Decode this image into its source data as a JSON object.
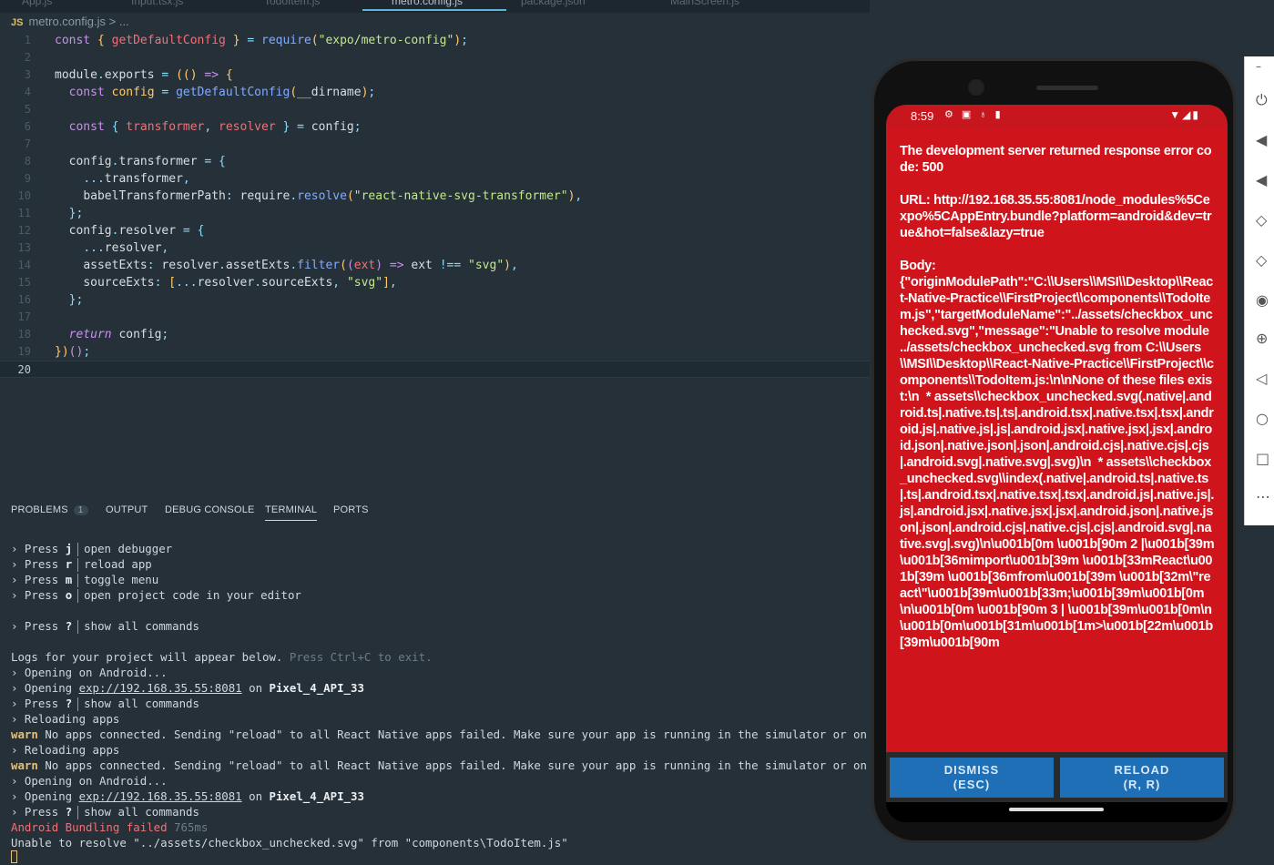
{
  "tabs": [
    {
      "label": "App.js",
      "active": false
    },
    {
      "label": "Input.tsx.js",
      "active": false
    },
    {
      "label": "TodoItem.js",
      "active": false
    },
    {
      "label": "metro.config.js",
      "active": true
    },
    {
      "label": "package.json",
      "active": false
    },
    {
      "label": "MainScreen.js",
      "active": false
    }
  ],
  "breadcrumb": {
    "lang": "JS",
    "file": "metro.config.js",
    "rest": "> ..."
  },
  "editor": {
    "line_numbers": [
      "1",
      "2",
      "3",
      "4",
      "5",
      "6",
      "7",
      "8",
      "9",
      "10",
      "11",
      "12",
      "13",
      "14",
      "15",
      "16",
      "17",
      "18",
      "19",
      "20"
    ],
    "current_line": "20"
  },
  "panel": {
    "tabs": [
      "PROBLEMS",
      "OUTPUT",
      "DEBUG CONSOLE",
      "TERMINAL",
      "PORTS"
    ],
    "problems_count": "1",
    "active_tab": "TERMINAL"
  },
  "terminal": {
    "press_j": "open debugger",
    "press_r": "reload app",
    "press_m": "toggle menu",
    "press_o": "open project code in your editor",
    "press_q": "show all commands",
    "logs_text": "Logs for your project will appear below.",
    "logs_hint": "Press Ctrl+C to exit.",
    "opening_android": "Opening on Android...",
    "exp_url": "exp://192.168.35.55:8081",
    "device": "Pixel_4_API_33",
    "reloading": "Reloading apps",
    "warn_label": "warn",
    "warn_text": "No apps connected. Sending \"reload\" to all React Native apps failed. Make sure your app is running in the simulator or on a phone",
    "bundling_failed": "Android Bundling failed",
    "bundling_time": "765ms",
    "unable": "Unable to resolve \"../assets/checkbox_unchecked.svg\" from \"components\\TodoItem.js\""
  },
  "phone": {
    "time": "8:59",
    "error_message": "The development server returned response error code: 500\n\nURL: http://192.168.35.55:8081/node_modules%5Cexpo%5CAppEntry.bundle?platform=android&dev=true&hot=false&lazy=true\n\nBody:\n{\"originModulePath\":\"C:\\\\Users\\\\MSI\\\\Desktop\\\\React-Native-Practice\\\\FirstProject\\\\components\\\\TodoItem.js\",\"targetModuleName\":\"../assets/checkbox_unchecked.svg\",\"message\":\"Unable to resolve module ../assets/checkbox_unchecked.svg from C:\\\\Users\\\\MSI\\\\Desktop\\\\React-Native-Practice\\\\FirstProject\\\\components\\\\TodoItem.js:\\n\\nNone of these files exist:\\n  * assets\\\\checkbox_unchecked.svg(.native|.android.ts|.native.ts|.ts|.android.tsx|.native.tsx|.tsx|.android.js|.native.js|.js|.android.jsx|.native.jsx|.jsx|.android.json|.native.json|.json|.android.cjs|.native.cjs|.cjs|.android.svg|.native.svg|.svg)\\n  * assets\\\\checkbox_unchecked.svg\\\\index(.native|.android.ts|.native.ts|.ts|.android.tsx|.native.tsx|.tsx|.android.js|.native.js|.js|.android.jsx|.native.jsx|.jsx|.android.json|.native.json|.json|.android.cjs|.native.cjs|.cjs|.android.svg|.native.svg|.svg)\\n\\u001b[0m \\u001b[90m 2 |\\u001b[39m \\u001b[36mimport\\u001b[39m \\u001b[33mReact\\u001b[39m \\u001b[36mfrom\\u001b[39m \\u001b[32m\\\"react\\\"\\u001b[39m\\u001b[33m;\\u001b[39m\\u001b[0m\\n\\u001b[0m \\u001b[90m 3 | \\u001b[39m\\u001b[0m\\n\\u001b[0m\\u001b[31m\\u001b[1m>\\u001b[22m\\u001b[39m\\u001b[90m",
    "dismiss": "DISMISS",
    "dismiss_key": "(ESC)",
    "reload": "RELOAD",
    "reload_key": "(R, R)"
  },
  "colors": {
    "error_red": "#d0141c",
    "button_blue": "#1e6fb5",
    "editor_bg": "#253038"
  }
}
